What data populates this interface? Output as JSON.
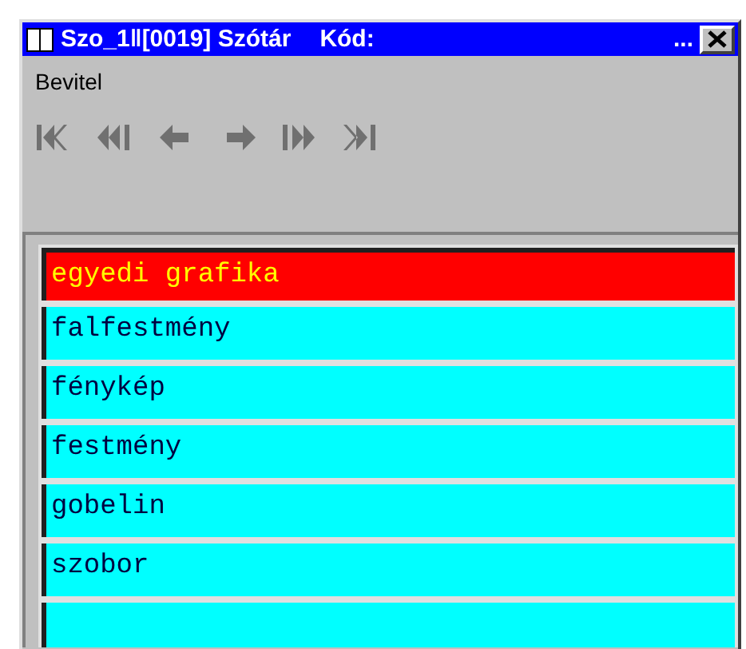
{
  "window": {
    "title": "Szo_1ǁ[0019] Szótár",
    "code_label": "Kód:",
    "code_value": "..."
  },
  "menu": [
    {
      "label": "Bevitel"
    }
  ],
  "toolbar": [
    {
      "kind": "first"
    },
    {
      "kind": "prev-page"
    },
    {
      "kind": "prev"
    },
    {
      "kind": "next"
    },
    {
      "kind": "next-page"
    },
    {
      "kind": "last"
    }
  ],
  "list": [
    {
      "text": "egyedi grafika",
      "selected": true
    },
    {
      "text": "falfestmény",
      "selected": false
    },
    {
      "text": "fénykép",
      "selected": false
    },
    {
      "text": "festmény",
      "selected": false
    },
    {
      "text": "gobelin",
      "selected": false
    },
    {
      "text": "szobor",
      "selected": false
    }
  ]
}
